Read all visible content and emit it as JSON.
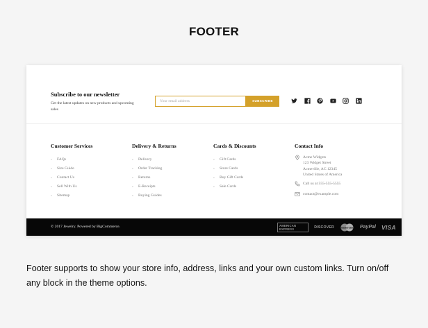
{
  "heading": "FOOTER",
  "newsletter": {
    "title": "Subscribe to our newsletter",
    "description": "Get the latest updates on new products and upcoming sales",
    "email_placeholder": "Your email address",
    "subscribe_label": "SUBSCRIBE",
    "accent_color": "#d4a12a"
  },
  "social_icons": [
    "twitter-icon",
    "facebook-icon",
    "pinterest-icon",
    "youtube-icon",
    "instagram-icon",
    "linkedin-icon"
  ],
  "columns": {
    "customer": {
      "title": "Customer Services",
      "items": [
        "FAQs",
        "Size Guide",
        "Contact Us",
        "Sell With Us",
        "Sitemap"
      ]
    },
    "delivery": {
      "title": "Delivery & Returns",
      "items": [
        "Delivery",
        "Order Tracking",
        "Returns",
        "E-Receipts",
        "Buying Guides"
      ]
    },
    "cards": {
      "title": "Cards & Discounts",
      "items": [
        "Gift Cards",
        "Store Cards",
        "Buy Gift Cards",
        "Sale Cards"
      ]
    },
    "contact": {
      "title": "Contact Info",
      "address": [
        "Acme Widgets",
        "123 Widget Street",
        "Acmeville, AC 12345",
        "United States of America"
      ],
      "phone": "Call us at 555-555-5555",
      "email": "contact@example.com"
    }
  },
  "bottom_bar": {
    "copyright": "© 2017 Jewelry. Powered by BigCommerce.",
    "payments": {
      "amex": "AMERICAN EXPRESS",
      "discover": "DISCOVER",
      "mastercard": "mastercard",
      "paypal": "PayPal",
      "visa": "VISA"
    }
  },
  "caption": "Footer supports to show your store info, address, links and your own custom links. Turn on/off any block in the theme options."
}
